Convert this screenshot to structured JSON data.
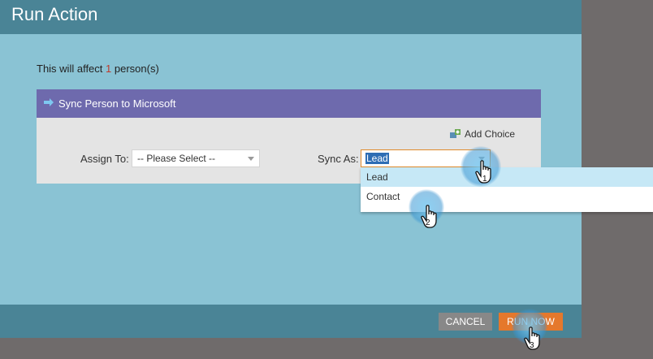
{
  "dialog": {
    "title": "Run Action",
    "affect_prefix": "This will affect ",
    "affect_count": "1",
    "affect_suffix": " person(s)"
  },
  "panel": {
    "header_label": "Sync Person to Microsoft",
    "add_choice_label": "Add Choice",
    "assign_label": "Assign To:",
    "assign_value": "-- Please Select --",
    "sync_label": "Sync As:",
    "sync_value": "Lead"
  },
  "dropdown": {
    "options": [
      "Lead",
      "Contact"
    ]
  },
  "footer": {
    "cancel_label": "CANCEL",
    "run_label": "RUN NOW"
  },
  "callouts": [
    "1",
    "2",
    "3"
  ],
  "colors": {
    "title_bar": "#4a8496",
    "panel_header": "#6e6aad",
    "run_button": "#e5782c",
    "cancel_button": "#888888"
  }
}
